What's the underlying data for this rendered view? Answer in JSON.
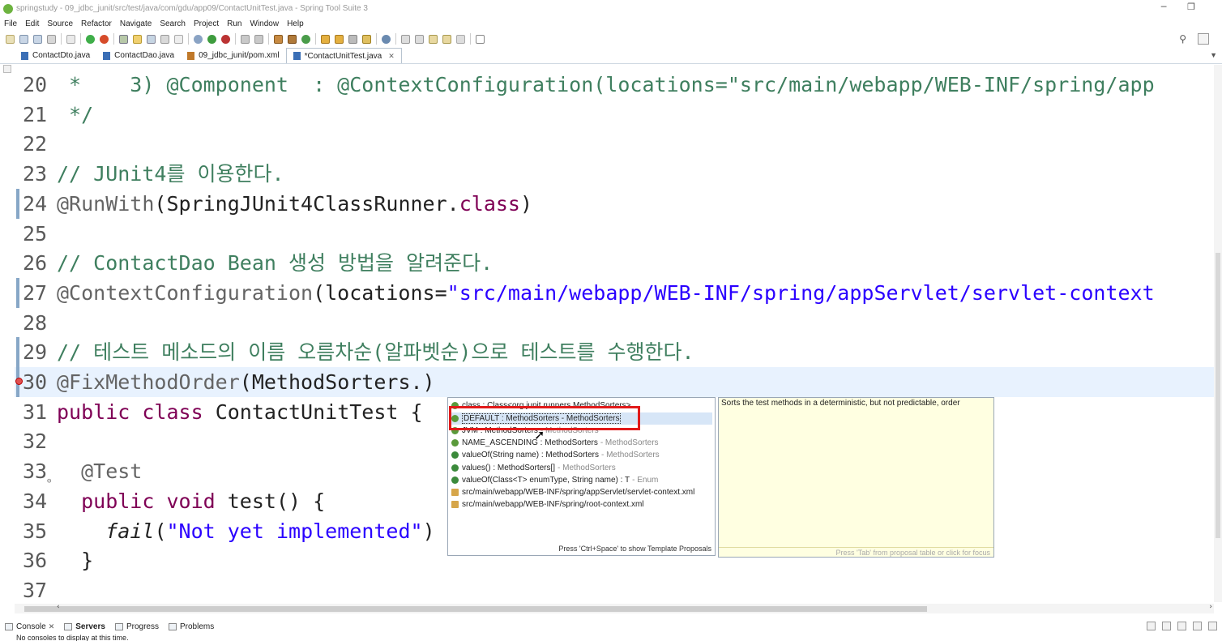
{
  "window": {
    "title": "springstudy - 09_jdbc_junit/src/test/java/com/gdu/app09/ContactUnitTest.java - Spring Tool Suite 3",
    "controls": [
      "─",
      "❐",
      "✕"
    ]
  },
  "menu": [
    "File",
    "Edit",
    "Source",
    "Refactor",
    "Navigate",
    "Search",
    "Project",
    "Run",
    "Window",
    "Help"
  ],
  "tabs": [
    {
      "label": "ContactDto.java",
      "active": false,
      "icon_color": "#3b6fb6"
    },
    {
      "label": "ContactDao.java",
      "active": false,
      "icon_color": "#3b6fb6"
    },
    {
      "label": "09_jdbc_junit/pom.xml",
      "active": false,
      "icon_color": "#c0792a"
    },
    {
      "label": "*ContactUnitTest.java",
      "active": true,
      "icon_color": "#3b6fb6"
    }
  ],
  "editor": {
    "lines": [
      {
        "no": "20",
        "tokens": [
          {
            "t": " *    3) @Component  : @ContextConfiguration(locations=\"src/main/webapp/WEB-INF/spring/app",
            "c": "c-comment"
          }
        ]
      },
      {
        "no": "21",
        "tokens": [
          {
            "t": " */",
            "c": "c-comment"
          }
        ]
      },
      {
        "no": "22",
        "tokens": []
      },
      {
        "no": "23",
        "tokens": [
          {
            "t": "// JUnit4를 이용한다.",
            "c": "c-comment"
          }
        ]
      },
      {
        "no": "24",
        "tokens": [
          {
            "t": "@RunWith",
            "c": "c-annot"
          },
          {
            "t": "(SpringJUnit4ClassRunner.",
            "c": "c-plain"
          },
          {
            "t": "class",
            "c": "c-kw"
          },
          {
            "t": ")",
            "c": "c-plain"
          }
        ]
      },
      {
        "no": "25",
        "tokens": []
      },
      {
        "no": "26",
        "tokens": [
          {
            "t": "// ContactDao Bean 생성 방법을 알려준다.",
            "c": "c-comment"
          }
        ]
      },
      {
        "no": "27",
        "tokens": [
          {
            "t": "@ContextConfiguration",
            "c": "c-annot"
          },
          {
            "t": "(locations=",
            "c": "c-plain"
          },
          {
            "t": "\"src/main/webapp/WEB-INF/spring/appServlet/servlet-context",
            "c": "c-str"
          }
        ]
      },
      {
        "no": "28",
        "tokens": []
      },
      {
        "no": "29",
        "tokens": [
          {
            "t": "// 테스트 메소드의 이름 오름차순(알파벳순)으로 테스트를 수행한다.",
            "c": "c-comment"
          }
        ]
      },
      {
        "no": "30",
        "tokens": [
          {
            "t": "@FixMethodOrder",
            "c": "c-annot"
          },
          {
            "t": "(MethodSorters.)",
            "c": "c-plain"
          }
        ]
      },
      {
        "no": "31",
        "tokens": [
          {
            "t": "public",
            "c": "c-kw"
          },
          {
            "t": " ",
            "c": "c-plain"
          },
          {
            "t": "class",
            "c": "c-kw"
          },
          {
            "t": " ContactUnitTest {",
            "c": "c-plain"
          }
        ]
      },
      {
        "no": "32",
        "tokens": []
      },
      {
        "no": "33",
        "tokens": [
          {
            "t": "  @Test",
            "c": "c-annot"
          }
        ]
      },
      {
        "no": "34",
        "tokens": [
          {
            "t": "  public",
            "c": "c-kw"
          },
          {
            "t": " ",
            "c": "c-plain"
          },
          {
            "t": "void",
            "c": "c-kw"
          },
          {
            "t": " test() {",
            "c": "c-plain"
          }
        ]
      },
      {
        "no": "35",
        "tokens": [
          {
            "t": "    ",
            "c": "c-plain"
          },
          {
            "t": "fail",
            "c": "c-italic"
          },
          {
            "t": "(",
            "c": "c-plain"
          },
          {
            "t": "\"Not yet implemented\"",
            "c": "c-str"
          },
          {
            "t": ")",
            "c": "c-plain"
          }
        ]
      },
      {
        "no": "36",
        "tokens": [
          {
            "t": "  }",
            "c": "c-plain"
          }
        ]
      },
      {
        "no": "37",
        "tokens": []
      }
    ]
  },
  "completion": {
    "proposals": [
      {
        "text": "class : Class<org.junit.runners.MethodSorters>",
        "qualifier": "",
        "kind": "field",
        "selected": false
      },
      {
        "text": "DEFAULT : MethodSorters - MethodSorters",
        "qualifier": "",
        "kind": "field",
        "selected": true
      },
      {
        "text": "JVM : MethodSorters",
        "qualifier": "- MethodSorters",
        "kind": "field",
        "selected": false
      },
      {
        "text": "NAME_ASCENDING : MethodSorters",
        "qualifier": "- MethodSorters",
        "kind": "field",
        "selected": false
      },
      {
        "text": "valueOf(String name) : MethodSorters",
        "qualifier": "- MethodSorters",
        "kind": "method",
        "selected": false
      },
      {
        "text": "values() : MethodSorters[]",
        "qualifier": "- MethodSorters",
        "kind": "method",
        "selected": false
      },
      {
        "text": "valueOf(Class<T> enumType, String name) : T",
        "qualifier": "- Enum",
        "kind": "method",
        "selected": false
      },
      {
        "text": "src/main/webapp/WEB-INF/spring/appServlet/servlet-context.xml",
        "qualifier": "",
        "kind": "file",
        "selected": false
      },
      {
        "text": "src/main/webapp/WEB-INF/spring/root-context.xml",
        "qualifier": "",
        "kind": "file",
        "selected": false
      }
    ],
    "footer": "Press 'Ctrl+Space' to show Template Proposals"
  },
  "info_popup": {
    "text": "Sorts the test methods in a deterministic, but not predictable, order",
    "footer": "Press 'Tab' from proposal table or click for focus"
  },
  "bottom_views": [
    {
      "label": "Console",
      "active": false,
      "closable": true
    },
    {
      "label": "Servers",
      "active": true,
      "closable": false
    },
    {
      "label": "Progress",
      "active": false,
      "closable": false
    },
    {
      "label": "Problems",
      "active": false,
      "closable": false
    }
  ],
  "console_message": "No consoles to display at this time.",
  "icons": {
    "search": "search-icon",
    "scroll_left": "‹",
    "scroll_right": "›",
    "tabs_menu": "▼"
  }
}
